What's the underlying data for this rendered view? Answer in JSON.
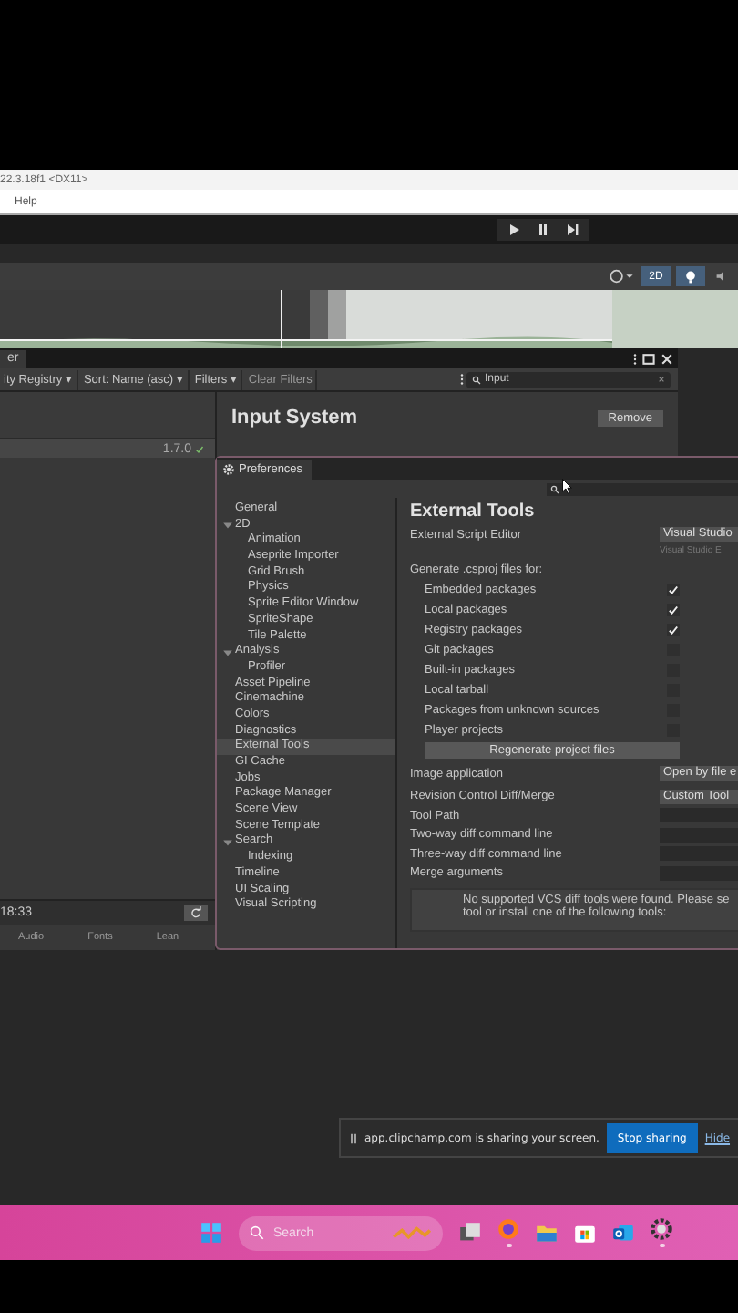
{
  "title_bar": {
    "title": "22.3.18f1 <DX11>"
  },
  "menu_bar": {
    "items": [
      "Help"
    ]
  },
  "play_controls": [
    {
      "kind": "play"
    },
    {
      "kind": "pause"
    },
    {
      "kind": "step"
    }
  ],
  "scene_toolbar": {
    "mode_2d": {
      "label": "2D",
      "selected": true
    },
    "light_on": true
  },
  "package_manager": {
    "tab": "er",
    "filters": [
      "ity Registry ▾",
      "Sort: Name (asc) ▾",
      "Filters ▾"
    ],
    "clear_filters": "Clear Filters",
    "search": {
      "value": "Input"
    },
    "list": [
      {
        "version": "1.7.0",
        "selected": true
      }
    ],
    "details": {
      "name": "Input System",
      "remove": "Remove"
    },
    "updated": "18:33",
    "bottom_tabs": [
      "Audio",
      "Fonts",
      "Lean"
    ]
  },
  "preferences": {
    "title": "Preferences",
    "sidebar": [
      {
        "label": "General",
        "selected": false
      },
      {
        "label": "2D",
        "selected": false,
        "expanded": true,
        "children": [
          {
            "label": "Animation",
            "selected": false
          },
          {
            "label": "Aseprite Importer",
            "selected": false
          },
          {
            "label": "Grid Brush",
            "selected": false
          },
          {
            "label": "Physics",
            "selected": false
          },
          {
            "label": "Sprite Editor Window",
            "selected": false
          },
          {
            "label": "SpriteShape",
            "selected": false
          },
          {
            "label": "Tile Palette",
            "selected": false
          }
        ]
      },
      {
        "label": "Analysis",
        "selected": false,
        "expanded": true,
        "children": [
          {
            "label": "Profiler",
            "selected": false
          }
        ]
      },
      {
        "label": "Asset Pipeline",
        "selected": false
      },
      {
        "label": "Cinemachine",
        "selected": false
      },
      {
        "label": "Colors",
        "selected": false
      },
      {
        "label": "Diagnostics",
        "selected": false
      },
      {
        "label": "External Tools",
        "selected": true
      },
      {
        "label": "GI Cache",
        "selected": false
      },
      {
        "label": "Jobs",
        "selected": false
      },
      {
        "label": "Package Manager",
        "selected": false
      },
      {
        "label": "Scene View",
        "selected": false
      },
      {
        "label": "Scene Template",
        "selected": false
      },
      {
        "label": "Search",
        "selected": false,
        "expanded": true,
        "children": [
          {
            "label": "Indexing",
            "selected": false
          }
        ]
      },
      {
        "label": "Timeline",
        "selected": false
      },
      {
        "label": "UI Scaling",
        "selected": false
      },
      {
        "label": "Visual Scripting",
        "selected": false
      }
    ],
    "heading": "External Tools",
    "script_editor": {
      "label": "External Script Editor",
      "value": "Visual Studio",
      "hint": "Visual Studio E"
    },
    "generate_label": "Generate .csproj files for:",
    "csproj": [
      {
        "label": "Embedded packages",
        "checked": true
      },
      {
        "label": "Local packages",
        "checked": true
      },
      {
        "label": "Registry packages",
        "checked": true
      },
      {
        "label": "Git packages",
        "checked": false
      },
      {
        "label": "Built-in packages",
        "checked": false
      },
      {
        "label": "Local tarball",
        "checked": false
      },
      {
        "label": "Packages from unknown sources",
        "checked": false
      },
      {
        "label": "Player projects",
        "checked": false
      }
    ],
    "regenerate": "Regenerate project files",
    "image_app": {
      "label": "Image application",
      "value": "Open by file e"
    },
    "diff_merge": {
      "label": "Revision Control Diff/Merge",
      "value": "Custom Tool"
    },
    "diff_fields": [
      "Tool Path",
      "Two-way diff command line",
      "Three-way diff command line",
      "Merge arguments"
    ],
    "help_lines": [
      "No supported VCS diff tools were found. Please se",
      "tool or install one of the following tools:"
    ]
  },
  "share_bar": {
    "message": "app.clipchamp.com is sharing your screen.",
    "stop": "Stop sharing",
    "hide": "Hide"
  },
  "taskbar": {
    "search_placeholder": "Search",
    "apps": [
      {
        "kind": "task-view",
        "running": false
      },
      {
        "kind": "browser",
        "running": true
      },
      {
        "kind": "folder",
        "running": false
      },
      {
        "kind": "store",
        "running": false
      },
      {
        "kind": "mail",
        "running": false
      },
      {
        "kind": "gear",
        "running": true
      }
    ]
  }
}
